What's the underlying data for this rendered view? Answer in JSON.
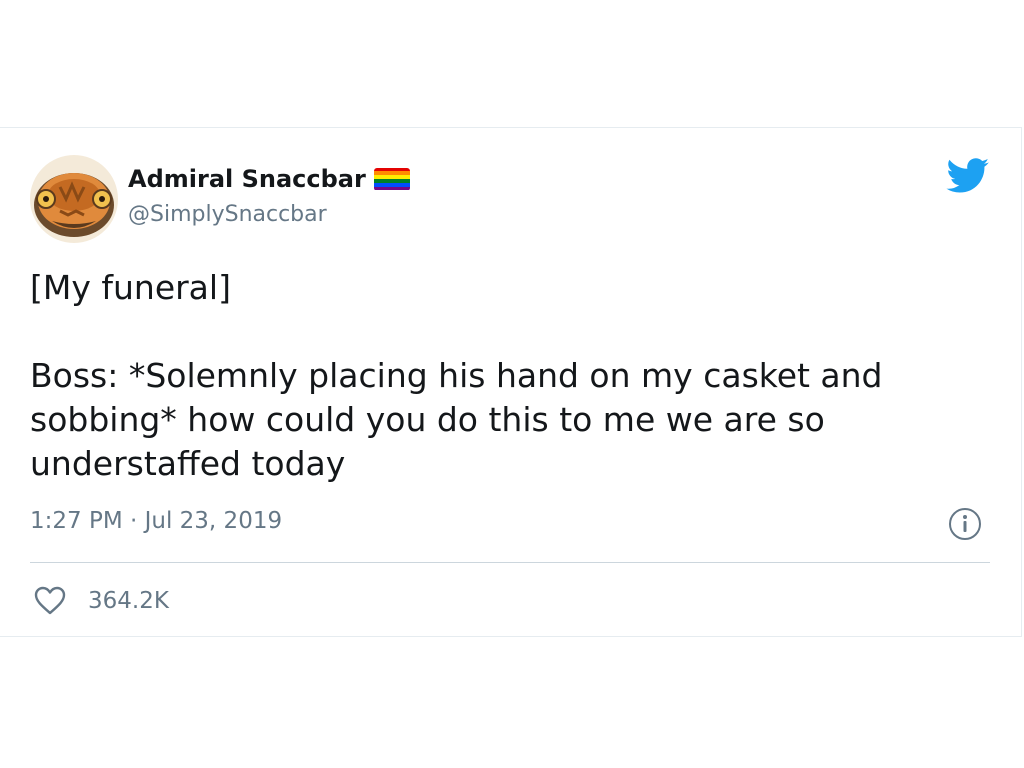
{
  "tweet": {
    "author": {
      "display_name": "Admiral Snaccbar",
      "handle": "@SimplySnaccbar",
      "avatar_icon": "admiral-ackbar-avatar",
      "flag_icon": "rainbow-flag-icon",
      "flag_colors": [
        "#e40303",
        "#ff8c00",
        "#ffed00",
        "#008026",
        "#004dff",
        "#750787"
      ]
    },
    "text": {
      "line1": "[My funeral]",
      "line2": "Boss: *Solemnly placing his hand on my casket and sobbing* how could you do this to me we are so understaffed today"
    },
    "timestamp": "1:27 PM · Jul 23, 2019",
    "likes": "364.2K",
    "icons": {
      "brand": "twitter-bird-icon",
      "info": "info-icon",
      "like": "heart-icon"
    },
    "colors": {
      "brand": "#1da1f2",
      "text": "#14171a",
      "secondary": "#657786",
      "divider": "#ccd6dd"
    }
  }
}
